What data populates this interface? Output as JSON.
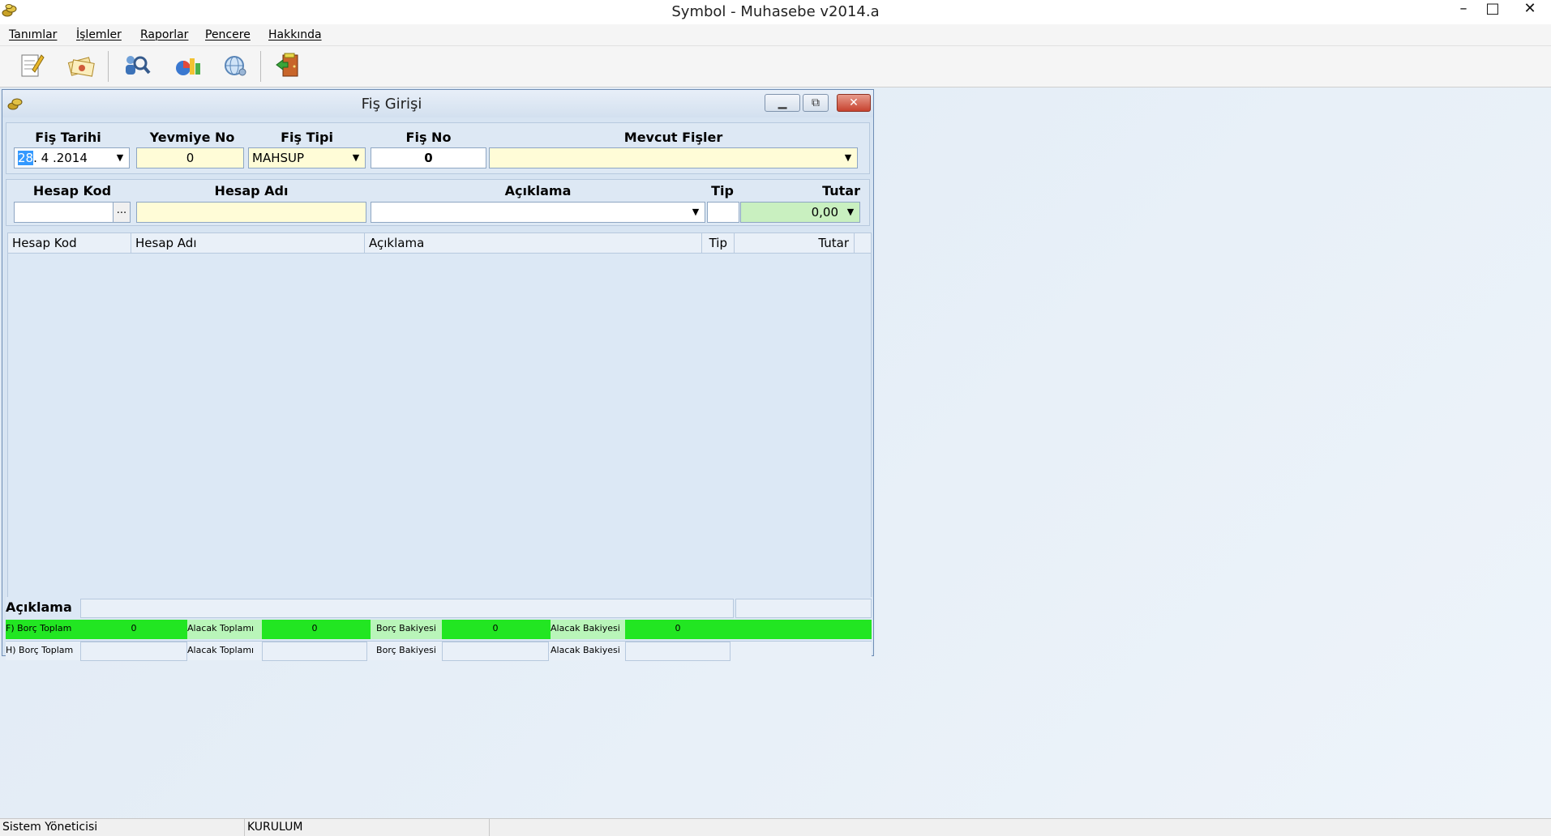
{
  "window": {
    "title": "Symbol - Muhasebe v2014.a",
    "min": "–",
    "max": "□",
    "close": "✕"
  },
  "menu": [
    "Tanımlar",
    "İşlemler",
    "Raporlar",
    "Pencere",
    "Hakkında"
  ],
  "toolbar": [
    "new-document-icon",
    "vouchers-icon",
    "search-users-icon",
    "chart-report-icon",
    "settings-globe-icon",
    "exit-door-icon"
  ],
  "child": {
    "title": "Fiş Girişi",
    "header": {
      "fis_tarihi_label": "Fiş Tarihi",
      "fis_tarihi_day": "28",
      "fis_tarihi_rest": ". 4 .2014",
      "yevmiye_no_label": "Yevmiye No",
      "yevmiye_no_value": "0",
      "fis_tipi_label": "Fiş Tipi",
      "fis_tipi_value": "MAHSUP",
      "fis_no_label": "Fiş No",
      "fis_no_value": "0",
      "mevcut_fisler_label": "Mevcut Fişler",
      "mevcut_fisler_value": ""
    },
    "entry": {
      "hesap_kod_label": "Hesap Kod",
      "hesap_adi_label": "Hesap Adı",
      "aciklama_label": "Açıklama",
      "tip_label": "Tip",
      "tutar_label": "Tutar",
      "hesap_kod_button": "...",
      "tutar_value": "0,00"
    },
    "grid": {
      "columns": [
        "Hesap Kod",
        "Hesap Adı",
        "Açıklama",
        "Tip",
        "Tutar"
      ],
      "rows": []
    },
    "footer": {
      "aciklama_label": "Açıklama",
      "f_row": {
        "borc_label": "F) Borç Toplam",
        "borc": "0",
        "alacak_label": "Alacak Toplamı",
        "alacak": "0",
        "borc_bakiye_label": "Borç Bakiyesi",
        "borc_bakiye": "0",
        "alacak_bakiye_label": "Alacak Bakiyesi",
        "alacak_bakiye": "0"
      },
      "h_row": {
        "borc_label": "H) Borç Toplam",
        "alacak_label": "Alacak Toplamı",
        "borc_bakiye_label": "Borç Bakiyesi",
        "alacak_bakiye_label": "Alacak Bakiyesi"
      }
    }
  },
  "status": {
    "user": "Sistem Yöneticisi",
    "company": "KURULUM"
  }
}
